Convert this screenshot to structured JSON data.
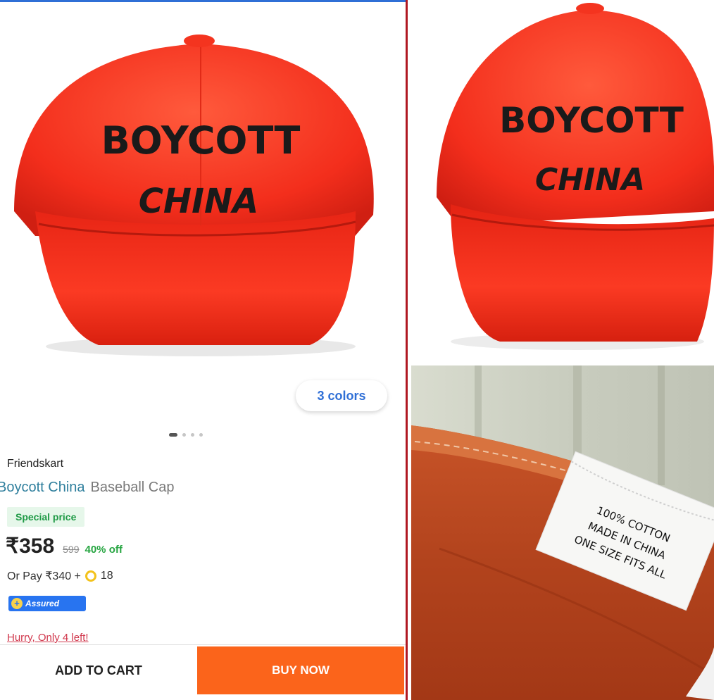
{
  "product_images": {
    "cap_front": {
      "line1": "BOYCOTT",
      "line2": "CHINA"
    },
    "cap_side": {
      "line1": "BOYCOTT",
      "line2": "CHINA"
    },
    "label": {
      "line1": "100% COTTON",
      "line2": "MADE IN CHINA",
      "line3": "ONE SIZE FITS ALL"
    }
  },
  "colors_chip": "3 colors",
  "product": {
    "seller": "Friendskart",
    "brand": "Boycott China",
    "type": "Baseball Cap",
    "special_badge": "Special price",
    "price": "₹358",
    "mrp": "599",
    "discount": "40% off",
    "pay_prefix": "Or Pay ₹340 +",
    "coins": "18",
    "assured": "Assured",
    "stock_note": "Hurry, Only 4 left!"
  },
  "actions": {
    "add_to_cart": "ADD TO CART",
    "buy_now": "BUY NOW"
  },
  "colors": {
    "cap_red": "#ff3b24",
    "buy_now": "#fb641b",
    "accent_blue": "#2874f0",
    "offer_green": "#26a541"
  },
  "icons": [
    "coin-icon",
    "plus-icon"
  ]
}
